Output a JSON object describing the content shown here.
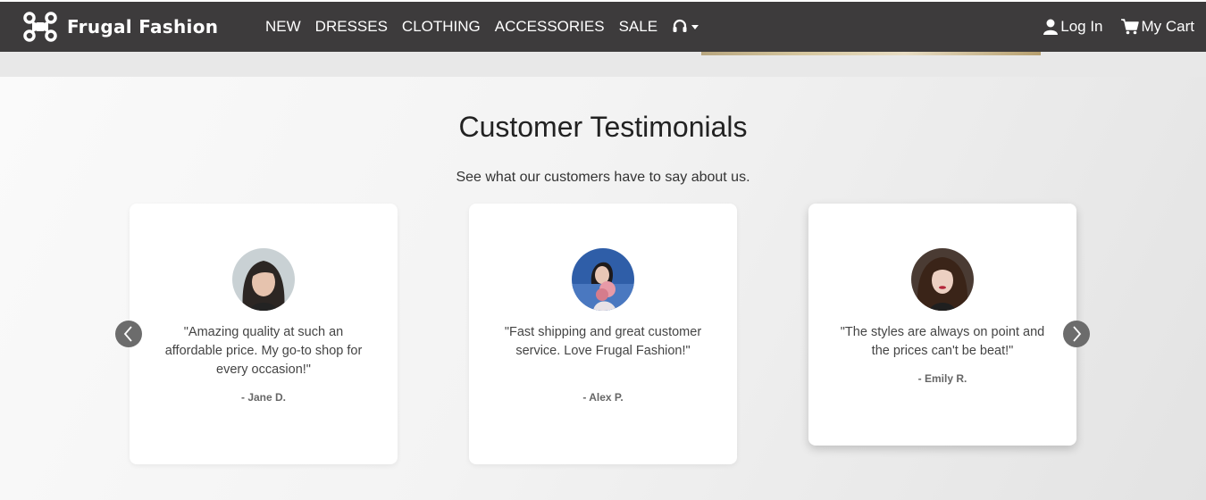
{
  "brand": {
    "name": "Frugal Fashion",
    "logo_icon": "drone-icon"
  },
  "nav": {
    "links": [
      "NEW",
      "DRESSES",
      "CLOTHING",
      "ACCESSORIES",
      "SALE"
    ],
    "support_icon": "headset-icon"
  },
  "header_actions": {
    "login_label": "Log In",
    "cart_label": "My Cart"
  },
  "testimonials": {
    "title": "Customer Testimonials",
    "subtitle": "See what our customers have to say about us.",
    "items": [
      {
        "quote": "\"Amazing quality at such an affordable price. My go-to shop for every occasion!\"",
        "author": "- Jane D."
      },
      {
        "quote": "\"Fast shipping and great customer service. Love Frugal Fashion!\"",
        "author": "- Alex P."
      },
      {
        "quote": "\"The styles are always on point and the prices can't be beat!\"",
        "author": "- Emily R."
      }
    ],
    "prev_icon": "chevron-left-icon",
    "next_icon": "chevron-right-icon"
  },
  "colors": {
    "navbar": "#3d3b3c",
    "carousel_button": "#6c6c6c"
  }
}
